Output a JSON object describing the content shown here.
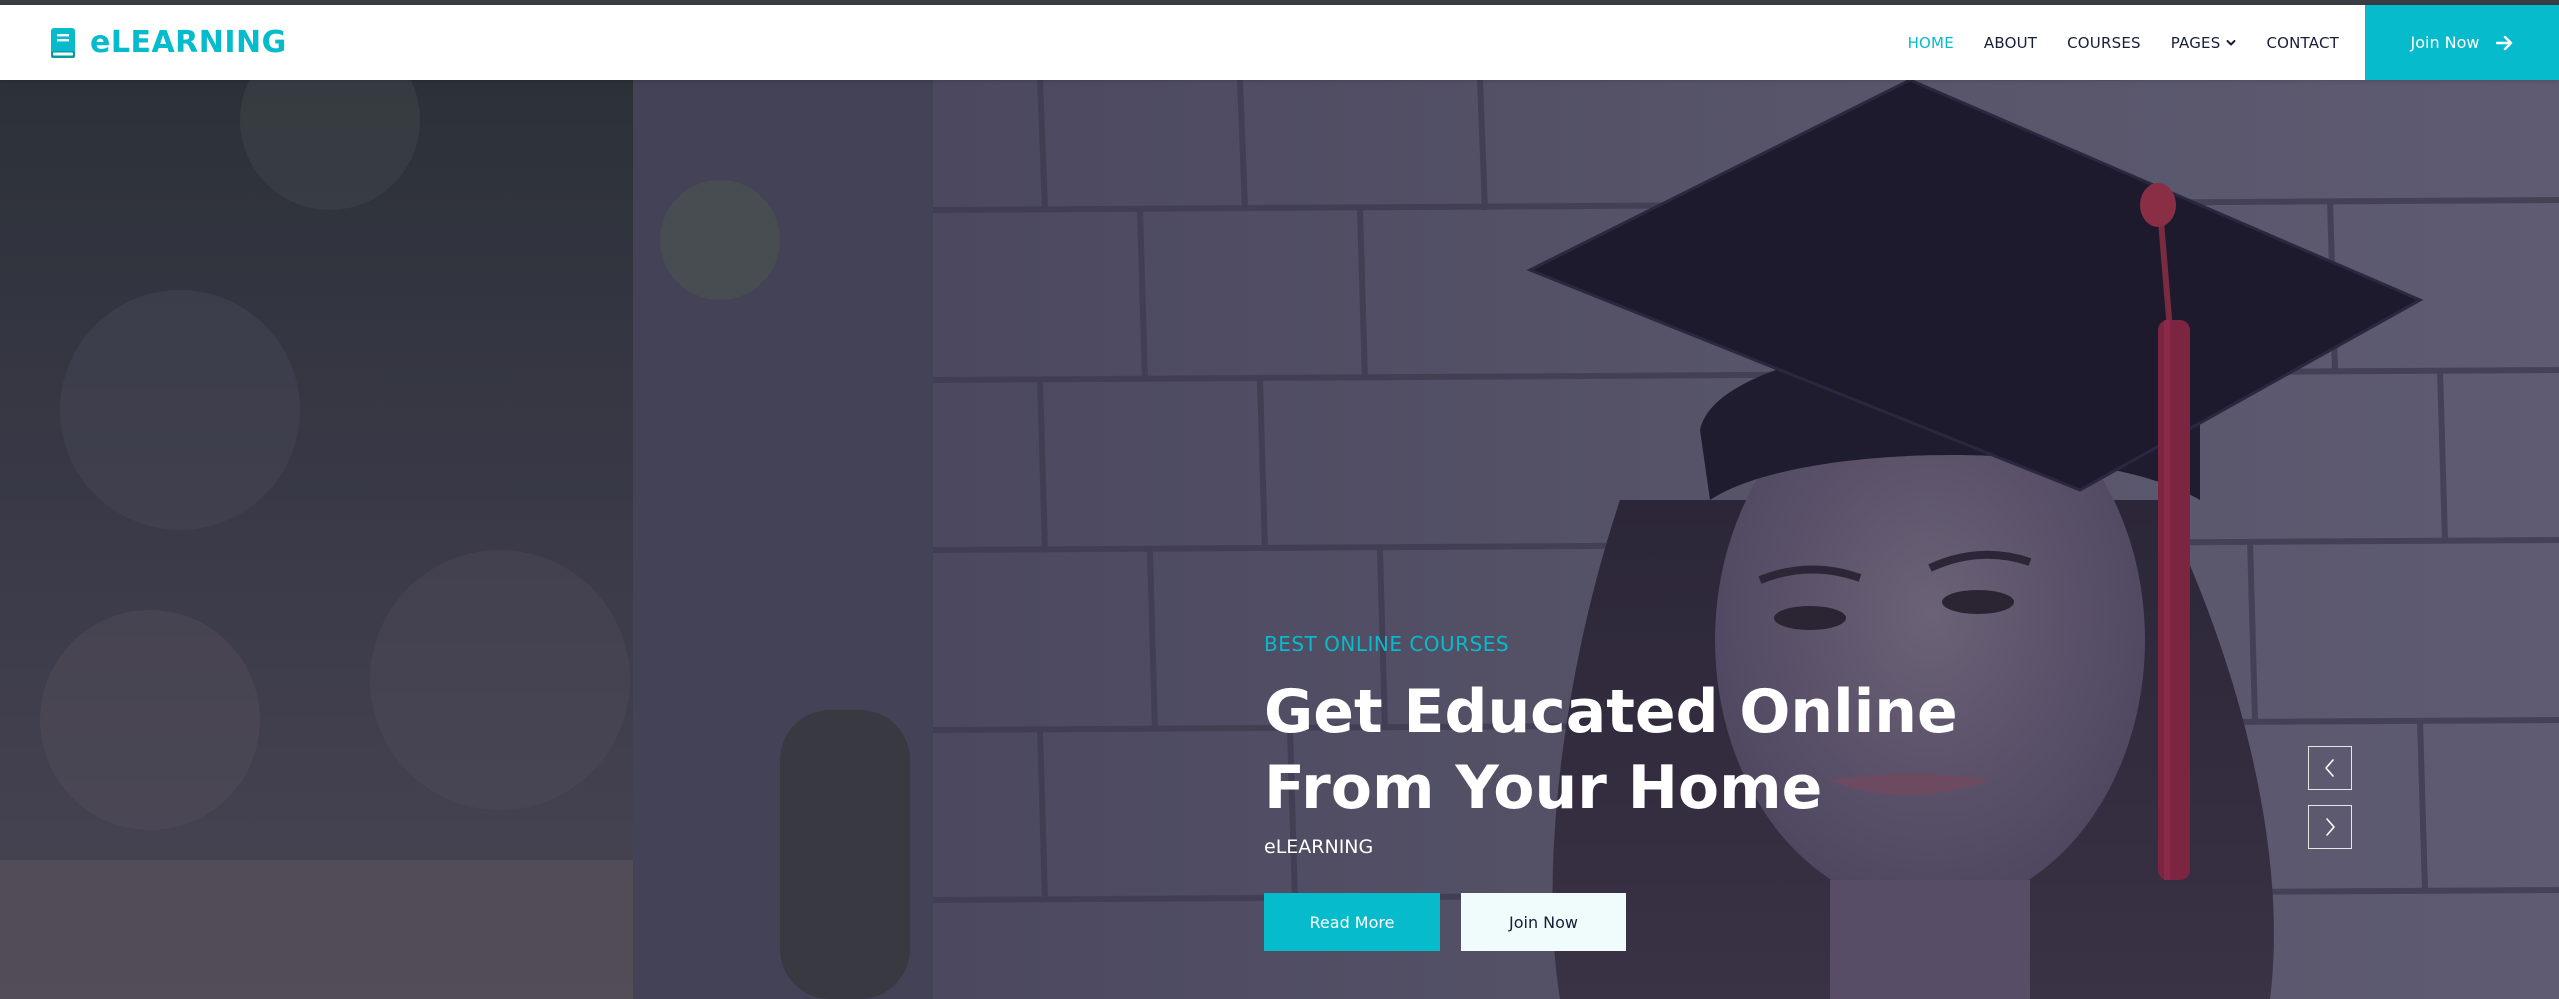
{
  "brand": {
    "name": "eLEARNING",
    "icon": "book-icon",
    "color": "#06bbcc"
  },
  "nav": {
    "items": [
      {
        "label": "HOME",
        "active": true
      },
      {
        "label": "ABOUT",
        "active": false
      },
      {
        "label": "COURSES",
        "active": false
      },
      {
        "label": "PAGES",
        "active": false,
        "dropdown": true
      },
      {
        "label": "CONTACT",
        "active": false
      }
    ],
    "join_label": "Join Now",
    "join_icon": "arrow-right-icon"
  },
  "hero": {
    "subtitle": "BEST ONLINE COURSES",
    "title": "Get Educated Online From Your Home",
    "tagline": "eLEARNING",
    "buttons": {
      "read_more": "Read More",
      "join_now": "Join Now"
    },
    "carousel": {
      "prev_icon": "chevron-left-icon",
      "next_icon": "chevron-right-icon"
    },
    "image": "graduate-student-photo"
  },
  "colors": {
    "primary": "#06bbcc",
    "dark": "#181d38",
    "light": "#f0fbfc",
    "overlay": "#24223c"
  }
}
